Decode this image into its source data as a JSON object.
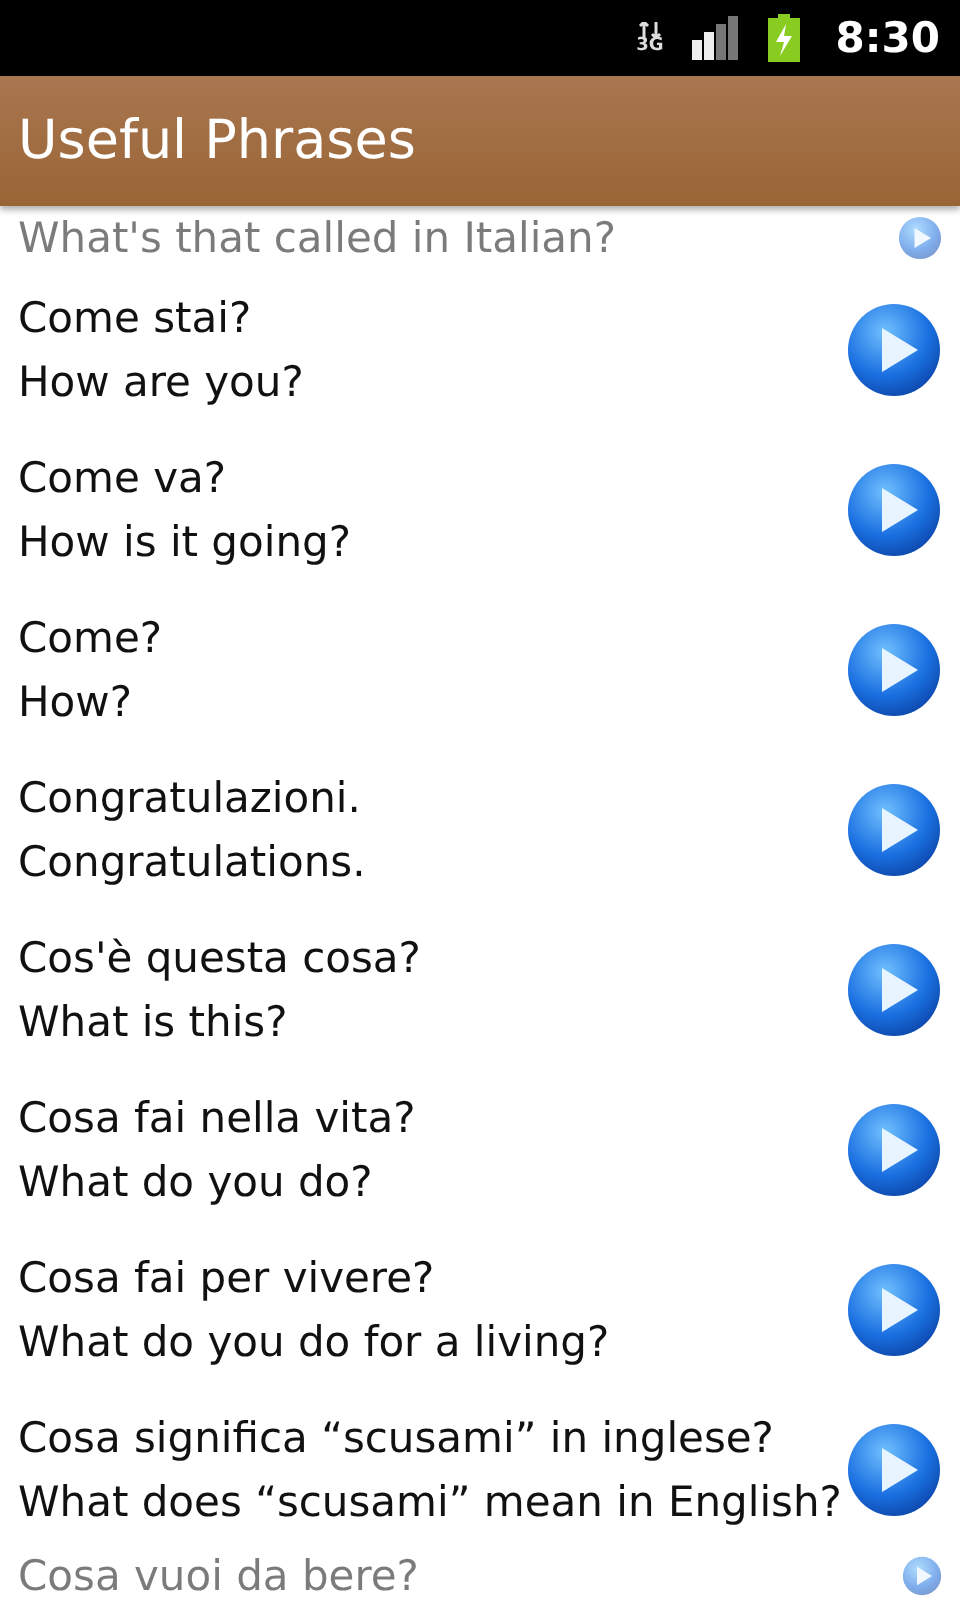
{
  "status_bar": {
    "network": "3G",
    "time": "8:30"
  },
  "title": "Useful Phrases",
  "phrases": [
    {
      "kind": "cut-top",
      "english": "What's that called in Italian?"
    },
    {
      "kind": "full",
      "italian": "Come stai?",
      "english": "How are you?"
    },
    {
      "kind": "full",
      "italian": "Come va?",
      "english": "How is it going?"
    },
    {
      "kind": "full",
      "italian": "Come?",
      "english": "How?"
    },
    {
      "kind": "full",
      "italian": "Congratulazioni.",
      "english": "Congratulations."
    },
    {
      "kind": "full",
      "italian": "Cos'è questa cosa?",
      "english": "What is this?"
    },
    {
      "kind": "full",
      "italian": "Cosa fai nella vita?",
      "english": "What do you do?"
    },
    {
      "kind": "full",
      "italian": "Cosa fai per vivere?",
      "english": "What do you do for a living?"
    },
    {
      "kind": "full",
      "italian": "Cosa significa “scusami” in inglese?",
      "english": "What does “scusami” mean in English?"
    },
    {
      "kind": "cut-bottom",
      "italian": "Cosa vuoi da bere?"
    }
  ]
}
